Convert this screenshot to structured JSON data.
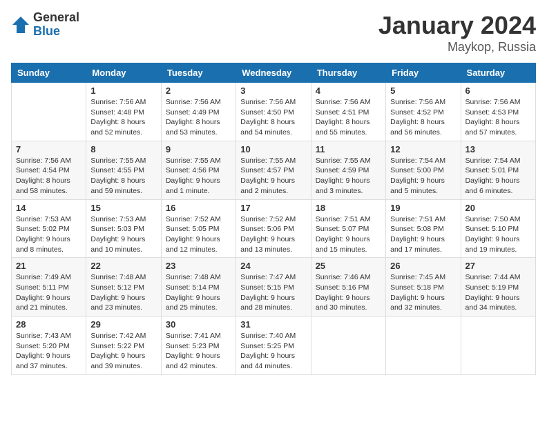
{
  "logo": {
    "general": "General",
    "blue": "Blue"
  },
  "title": "January 2024",
  "subtitle": "Maykop, Russia",
  "days_of_week": [
    "Sunday",
    "Monday",
    "Tuesday",
    "Wednesday",
    "Thursday",
    "Friday",
    "Saturday"
  ],
  "weeks": [
    [
      {
        "day": "",
        "info": ""
      },
      {
        "day": "1",
        "info": "Sunrise: 7:56 AM\nSunset: 4:48 PM\nDaylight: 8 hours\nand 52 minutes."
      },
      {
        "day": "2",
        "info": "Sunrise: 7:56 AM\nSunset: 4:49 PM\nDaylight: 8 hours\nand 53 minutes."
      },
      {
        "day": "3",
        "info": "Sunrise: 7:56 AM\nSunset: 4:50 PM\nDaylight: 8 hours\nand 54 minutes."
      },
      {
        "day": "4",
        "info": "Sunrise: 7:56 AM\nSunset: 4:51 PM\nDaylight: 8 hours\nand 55 minutes."
      },
      {
        "day": "5",
        "info": "Sunrise: 7:56 AM\nSunset: 4:52 PM\nDaylight: 8 hours\nand 56 minutes."
      },
      {
        "day": "6",
        "info": "Sunrise: 7:56 AM\nSunset: 4:53 PM\nDaylight: 8 hours\nand 57 minutes."
      }
    ],
    [
      {
        "day": "7",
        "info": "Sunrise: 7:56 AM\nSunset: 4:54 PM\nDaylight: 8 hours\nand 58 minutes."
      },
      {
        "day": "8",
        "info": "Sunrise: 7:55 AM\nSunset: 4:55 PM\nDaylight: 8 hours\nand 59 minutes."
      },
      {
        "day": "9",
        "info": "Sunrise: 7:55 AM\nSunset: 4:56 PM\nDaylight: 9 hours\nand 1 minute."
      },
      {
        "day": "10",
        "info": "Sunrise: 7:55 AM\nSunset: 4:57 PM\nDaylight: 9 hours\nand 2 minutes."
      },
      {
        "day": "11",
        "info": "Sunrise: 7:55 AM\nSunset: 4:59 PM\nDaylight: 9 hours\nand 3 minutes."
      },
      {
        "day": "12",
        "info": "Sunrise: 7:54 AM\nSunset: 5:00 PM\nDaylight: 9 hours\nand 5 minutes."
      },
      {
        "day": "13",
        "info": "Sunrise: 7:54 AM\nSunset: 5:01 PM\nDaylight: 9 hours\nand 6 minutes."
      }
    ],
    [
      {
        "day": "14",
        "info": "Sunrise: 7:53 AM\nSunset: 5:02 PM\nDaylight: 9 hours\nand 8 minutes."
      },
      {
        "day": "15",
        "info": "Sunrise: 7:53 AM\nSunset: 5:03 PM\nDaylight: 9 hours\nand 10 minutes."
      },
      {
        "day": "16",
        "info": "Sunrise: 7:52 AM\nSunset: 5:05 PM\nDaylight: 9 hours\nand 12 minutes."
      },
      {
        "day": "17",
        "info": "Sunrise: 7:52 AM\nSunset: 5:06 PM\nDaylight: 9 hours\nand 13 minutes."
      },
      {
        "day": "18",
        "info": "Sunrise: 7:51 AM\nSunset: 5:07 PM\nDaylight: 9 hours\nand 15 minutes."
      },
      {
        "day": "19",
        "info": "Sunrise: 7:51 AM\nSunset: 5:08 PM\nDaylight: 9 hours\nand 17 minutes."
      },
      {
        "day": "20",
        "info": "Sunrise: 7:50 AM\nSunset: 5:10 PM\nDaylight: 9 hours\nand 19 minutes."
      }
    ],
    [
      {
        "day": "21",
        "info": "Sunrise: 7:49 AM\nSunset: 5:11 PM\nDaylight: 9 hours\nand 21 minutes."
      },
      {
        "day": "22",
        "info": "Sunrise: 7:48 AM\nSunset: 5:12 PM\nDaylight: 9 hours\nand 23 minutes."
      },
      {
        "day": "23",
        "info": "Sunrise: 7:48 AM\nSunset: 5:14 PM\nDaylight: 9 hours\nand 25 minutes."
      },
      {
        "day": "24",
        "info": "Sunrise: 7:47 AM\nSunset: 5:15 PM\nDaylight: 9 hours\nand 28 minutes."
      },
      {
        "day": "25",
        "info": "Sunrise: 7:46 AM\nSunset: 5:16 PM\nDaylight: 9 hours\nand 30 minutes."
      },
      {
        "day": "26",
        "info": "Sunrise: 7:45 AM\nSunset: 5:18 PM\nDaylight: 9 hours\nand 32 minutes."
      },
      {
        "day": "27",
        "info": "Sunrise: 7:44 AM\nSunset: 5:19 PM\nDaylight: 9 hours\nand 34 minutes."
      }
    ],
    [
      {
        "day": "28",
        "info": "Sunrise: 7:43 AM\nSunset: 5:20 PM\nDaylight: 9 hours\nand 37 minutes."
      },
      {
        "day": "29",
        "info": "Sunrise: 7:42 AM\nSunset: 5:22 PM\nDaylight: 9 hours\nand 39 minutes."
      },
      {
        "day": "30",
        "info": "Sunrise: 7:41 AM\nSunset: 5:23 PM\nDaylight: 9 hours\nand 42 minutes."
      },
      {
        "day": "31",
        "info": "Sunrise: 7:40 AM\nSunset: 5:25 PM\nDaylight: 9 hours\nand 44 minutes."
      },
      {
        "day": "",
        "info": ""
      },
      {
        "day": "",
        "info": ""
      },
      {
        "day": "",
        "info": ""
      }
    ]
  ]
}
